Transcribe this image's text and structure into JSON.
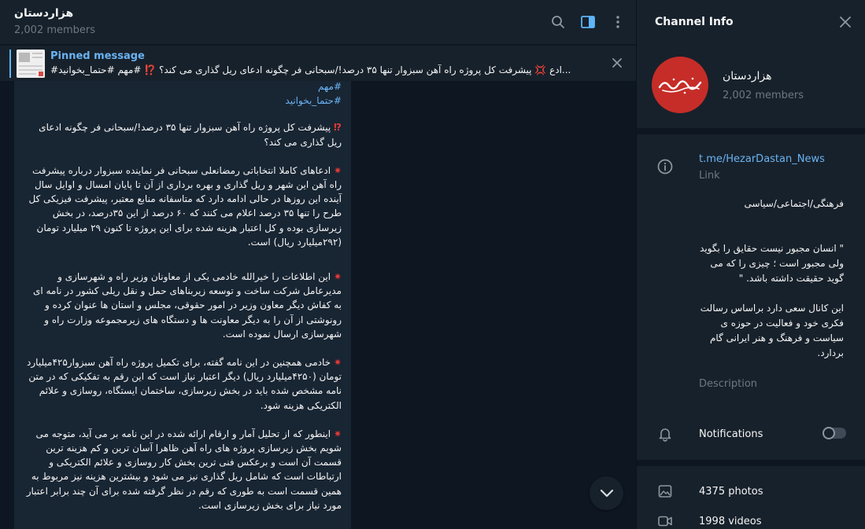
{
  "chat": {
    "title": "هزاردستان",
    "subtitle": "2,002 members"
  },
  "pinned": {
    "label": "Pinned message",
    "text": "#ادع 💢 پیشرفت کل پروژه راه آهن سبزوار تنها ۳۵ درصد!/سبحانی فر چگونه ادعای ریل گذاری می کند؟ ⁉️ #مهم #حتما_بخوانید..."
  },
  "message": {
    "tags": [
      "#مهم",
      "#حتما_بخوانید"
    ],
    "paragraphs": [
      "پیشرفت کل پروژه راه آهن سبزوار تنها ۳۵ درصد!/سبحانی فر چگونه ادعای ریل گذاری می کند؟",
      "ادعاهای کاملا انتخاباتی رمضانعلی سبحانی فر نماینده سبزوار درباره پیشرفت راه آهن این شهر و ریل گذاری و بهره برداری از آن تا پایان امسال و اوایل سال آینده این روزها در حالی ادامه دارد که متاسفانه منابع معتبر، پیشرفت فیزیکی کل طرح را تنها ۳۵ درصد اعلام می کنند که ۶۰ درصد از این ۳۵درصد، در بخش زیرسازی بوده و کل اعتبار هزینه شده برای این پروژه تا کنون ۲۹ میلیارد تومان (۲۹۲میلیارد ریال) است.",
      "این اطلاعات را خیرالله خادمی یکی از معاونان وزیر راه و شهرسازی و مدیرعامل شرکت ساخت و توسعه زیربناهای حمل و نقل ریلی کشور در نامه ای به کفاش دیگر معاون وزیر در امور حقوقی، مجلس و استان ها عنوان کرده و رونوشتی از آن را به دیگر معاونت ها و دستگاه های زیرمجموعه وزارت راه و شهرسازی ارسال نموده است.",
      "خادمی همچنین در این نامه گفته، برای تکمیل پروژه راه آهن سبزوار۴۲۵میلیارد تومان (۴۲۵۰میلیارد ریال) دیگر اعتبار نیاز است که این رقم به تفکیکی که در متن نامه مشخص شده باید در بخش زیرسازی، ساختمان ایستگاه، روسازی و علائم الکتریکی هزینه شود.",
      "اینطور که از تحلیل آمار و ارقام ارائه شده در این نامه بر می آید، متوجه می شویم بخش زیرسازی پروژه های راه آهن ظاهرا آسان ترین و کم هزینه ترین قسمت آن است و برعکس فنی ترین بخش کار روسازی و علائم الکتریکی و ارتباطات است که شامل ریل گذاری نیز می شود و بیشترین هزینه نیز مربوط به همین قسمت است به طوری که رقم در نظر گرفته شده برای آن چند برابر اعتبار مورد نیاز برای بخش زیرسازی است."
    ]
  },
  "panel": {
    "title": "Channel Info",
    "name": "هزاردستان",
    "members": "2,002 members",
    "link": "t.me/HezarDastan_News",
    "link_caption": "Link",
    "description_lines": [
      "فرهنگی/اجتماعی/سیاسی",
      "\" انسان مجبور نیست حقایق را بگوید ولی مجبور است ؛ چیزی را که می گوید حقیقت داشته باشد. \"",
      "این کانال سعی دارد براساس رسالت فکری خود و فعالیت در حوزه ی سیاست و فرهنگ و هنر ایرانی گام بردارد."
    ],
    "description_caption": "Description",
    "notifications_label": "Notifications",
    "notifications_on": false,
    "photos": "4375 photos",
    "videos": "1998 videos"
  },
  "colors": {
    "accent": "#6ab3f3",
    "panel_bg": "#17212b",
    "chat_bg": "#0e1621",
    "bubble_bg": "#182533",
    "avatar_red": "#c62d28"
  },
  "icons": [
    "search-icon",
    "sidebar-toggle-icon",
    "more-vertical-icon",
    "close-icon",
    "chevron-down-icon",
    "info-icon",
    "bell-icon",
    "photo-icon",
    "video-icon"
  ]
}
